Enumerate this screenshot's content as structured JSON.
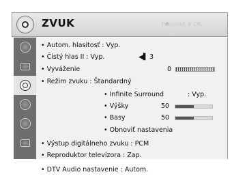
{
  "header": {
    "title": "ZVUK",
    "hint": "Presunúť ⊕ OK"
  },
  "sidebar": {
    "items": [
      {
        "icon": "picture-icon"
      },
      {
        "icon": "screen-icon"
      },
      {
        "icon": "sound-icon",
        "active": true
      },
      {
        "icon": "clock-icon"
      },
      {
        "icon": "lock-icon"
      },
      {
        "icon": "options-icon"
      }
    ]
  },
  "menu": {
    "auto_volume": "• Autom. hlasitosť    : Vyp.",
    "clear_voice": "• Čistý hlas II      : Vyp.",
    "clear_voice_level": "3",
    "balance": "• Vyváženie",
    "balance_value": "0",
    "sound_mode": "• Režim zvuku        : Štandardný",
    "infinite_surround": "• Infinite Surround",
    "infinite_surround_value": ": Vyp.",
    "treble": "• Výšky",
    "treble_value": "50",
    "bass": "• Basy",
    "bass_value": "50",
    "reset": "• Obnoviť nastavenia",
    "digital_out": "• Výstup digitálneho zvuku  : PCM",
    "tv_speaker": "• Reproduktor televízora   : Zap.",
    "dtv_audio": "• DTV Audio nastavenie : Autom."
  },
  "levels": {
    "treble": 0.5,
    "bass": 0.5
  }
}
